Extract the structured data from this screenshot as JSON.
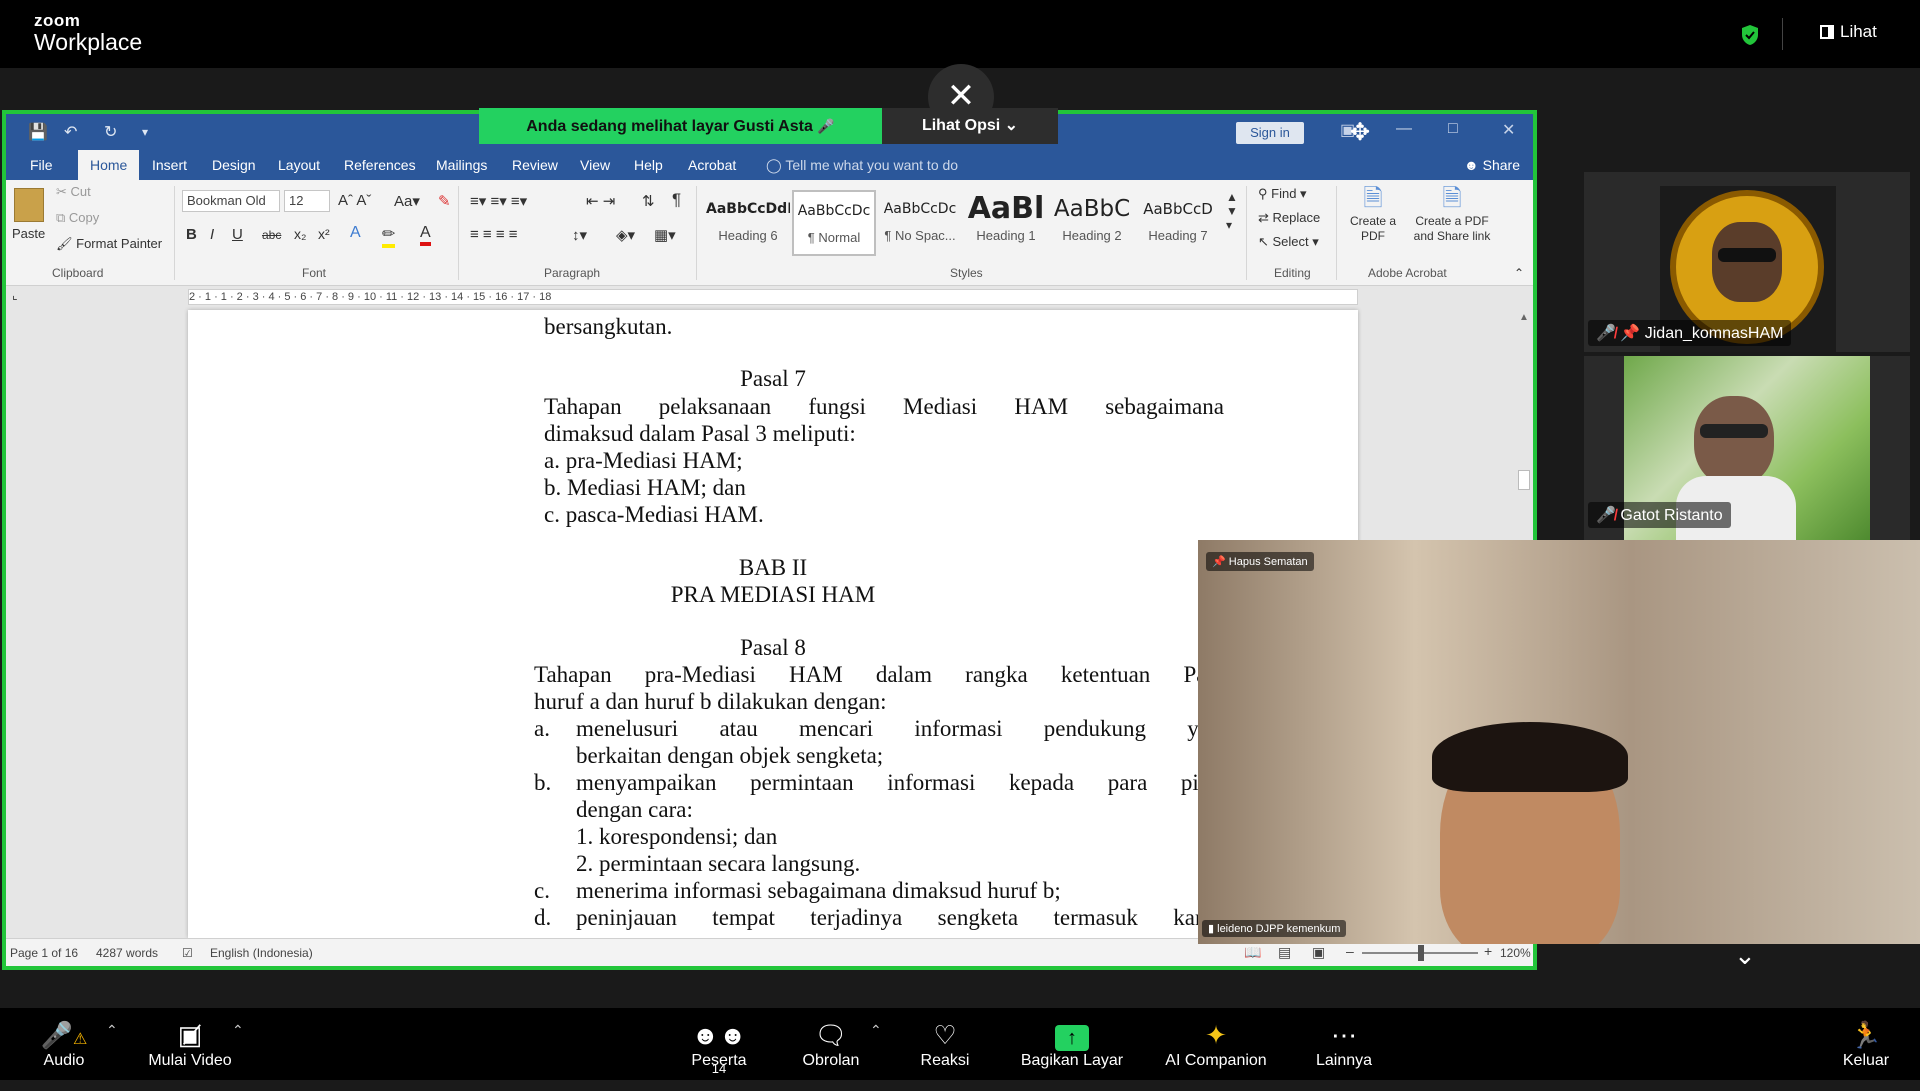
{
  "zoom": {
    "brand_top": "zoom",
    "brand_bottom": "Workplace",
    "view_label": "Lihat",
    "share_banner": "Anda sedang melihat layar  Gusti Asta",
    "view_options": "Lihat Opsi",
    "toolbar": {
      "audio": "Audio",
      "video": "Mulai Video",
      "participants": "Peserta",
      "participants_count": "14",
      "chat": "Obrolan",
      "reactions": "Reaksi",
      "share": "Bagikan Layar",
      "ai": "AI Companion",
      "more": "Lainnya",
      "leave": "Keluar"
    },
    "participants": [
      {
        "name": "Jidan_komnasHAM"
      },
      {
        "name": "Gatot Ristanto"
      },
      {
        "name": "leideno DJPP kemenkum",
        "badge": "Hapus Sematan"
      }
    ],
    "colors": {
      "accent_green": "#23d160",
      "word_blue": "#2b579a",
      "share_border": "#22c53a"
    }
  },
  "word": {
    "signin": "Sign in",
    "tabs": [
      "File",
      "Home",
      "Insert",
      "Design",
      "Layout",
      "References",
      "Mailings",
      "Review",
      "View",
      "Help",
      "Acrobat"
    ],
    "tellme": "Tell me what you want to do",
    "share": "Share",
    "clipboard": {
      "paste": "Paste",
      "cut": "Cut",
      "copy": "Copy",
      "format_painter": "Format Painter",
      "label": "Clipboard"
    },
    "font": {
      "name": "Bookman Old",
      "size": "12",
      "label": "Font"
    },
    "paragraph_label": "Paragraph",
    "styles": [
      {
        "preview": "AaBbCcDdI",
        "name": "Heading 6"
      },
      {
        "preview": "AaBbCcDc",
        "name": "¶ Normal"
      },
      {
        "preview": "AaBbCcDc",
        "name": "¶ No Spac..."
      },
      {
        "preview": "AaBl",
        "name": "Heading 1"
      },
      {
        "preview": "AaBbC",
        "name": "Heading 2"
      },
      {
        "preview": "AaBbCcD",
        "name": "Heading 7"
      }
    ],
    "styles_label": "Styles",
    "editing": {
      "find": "Find",
      "replace": "Replace",
      "select": "Select",
      "label": "Editing"
    },
    "acrobat": {
      "create_pdf": "Create a PDF",
      "create_share": "Create a PDF and Share link",
      "label": "Adobe Acrobat"
    },
    "ruler": "2 · 1 · 1 · 2 · 3 · 4 · 5 · 6 · 7 · 8 · 9 · 10 · 11 · 12 · 13 · 14 · 15 · 16 · 17 · 18",
    "status": {
      "page": "Page 1 of 16",
      "words": "4287 words",
      "language": "English (Indonesia)",
      "zoom": "120%"
    }
  },
  "document": {
    "lines": [
      "bersangkutan.",
      "Pasal 7",
      "Tahapan pelaksanaan fungsi Mediasi HAM sebagaimana",
      "dimaksud dalam Pasal 3 meliputi:",
      "a.  pra-Mediasi HAM;",
      "b.  Mediasi HAM; dan",
      "c.  pasca-Mediasi HAM.",
      "BAB II",
      "PRA MEDIASI HAM",
      "Pasal 8",
      "Tahapan pra-Mediasi HAM dalam rangka ketentuan Pasal",
      "huruf a dan huruf b dilakukan dengan:",
      "a.",
      "menelusuri atau mencari informasi pendukung yang",
      "berkaitan dengan objek sengketa;",
      "b.",
      "menyampaikan permintaan informasi kepada para pihak",
      "dengan cara:",
      "1.  korespondensi; dan",
      "2.  permintaan secara langsung.",
      "c.",
      "menerima informasi sebagaimana dimaksud huruf b;",
      "d.",
      "peninjauan tempat terjadinya sengketa termasuk kantor"
    ]
  }
}
